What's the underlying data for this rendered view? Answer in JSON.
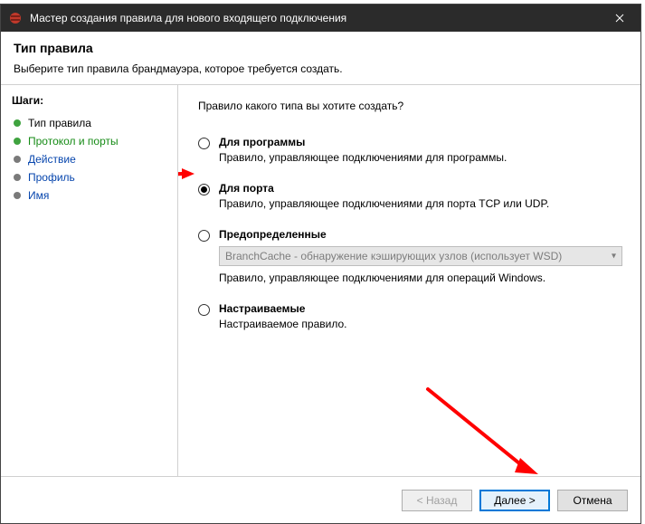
{
  "colors": {
    "titlebar_bg": "#2b2b2b",
    "accent_green": "#3fa33f",
    "link": "#0645ad",
    "arrow": "#ff0000",
    "default_btn_border": "#0078d7"
  },
  "titlebar": {
    "title": "Мастер создания правила для нового входящего подключения"
  },
  "header": {
    "heading": "Тип правила",
    "sub": "Выберите тип правила брандмауэра, которое требуется создать."
  },
  "sidebar": {
    "label": "Шаги:",
    "steps": [
      {
        "label": "Тип правила",
        "state": "current"
      },
      {
        "label": "Протокол и порты",
        "state": "next"
      },
      {
        "label": "Действие",
        "state": "pending"
      },
      {
        "label": "Профиль",
        "state": "pending"
      },
      {
        "label": "Имя",
        "state": "pending"
      }
    ]
  },
  "main": {
    "prompt": "Правило какого типа вы хотите создать?",
    "options": [
      {
        "title": "Для программы",
        "desc": "Правило, управляющее подключениями для программы.",
        "selected": false
      },
      {
        "title": "Для порта",
        "desc": "Правило, управляющее подключениями для порта TCP или UDP.",
        "selected": true
      },
      {
        "title": "Предопределенные",
        "desc": "Правило, управляющее подключениями для операций Windows.",
        "selected": false,
        "dropdown": "BranchCache - обнаружение кэширующих узлов (использует WSD)"
      },
      {
        "title": "Настраиваемые",
        "desc": "Настраиваемое правило.",
        "selected": false
      }
    ]
  },
  "footer": {
    "back": "< Назад",
    "next": "Далее >",
    "cancel": "Отмена"
  }
}
